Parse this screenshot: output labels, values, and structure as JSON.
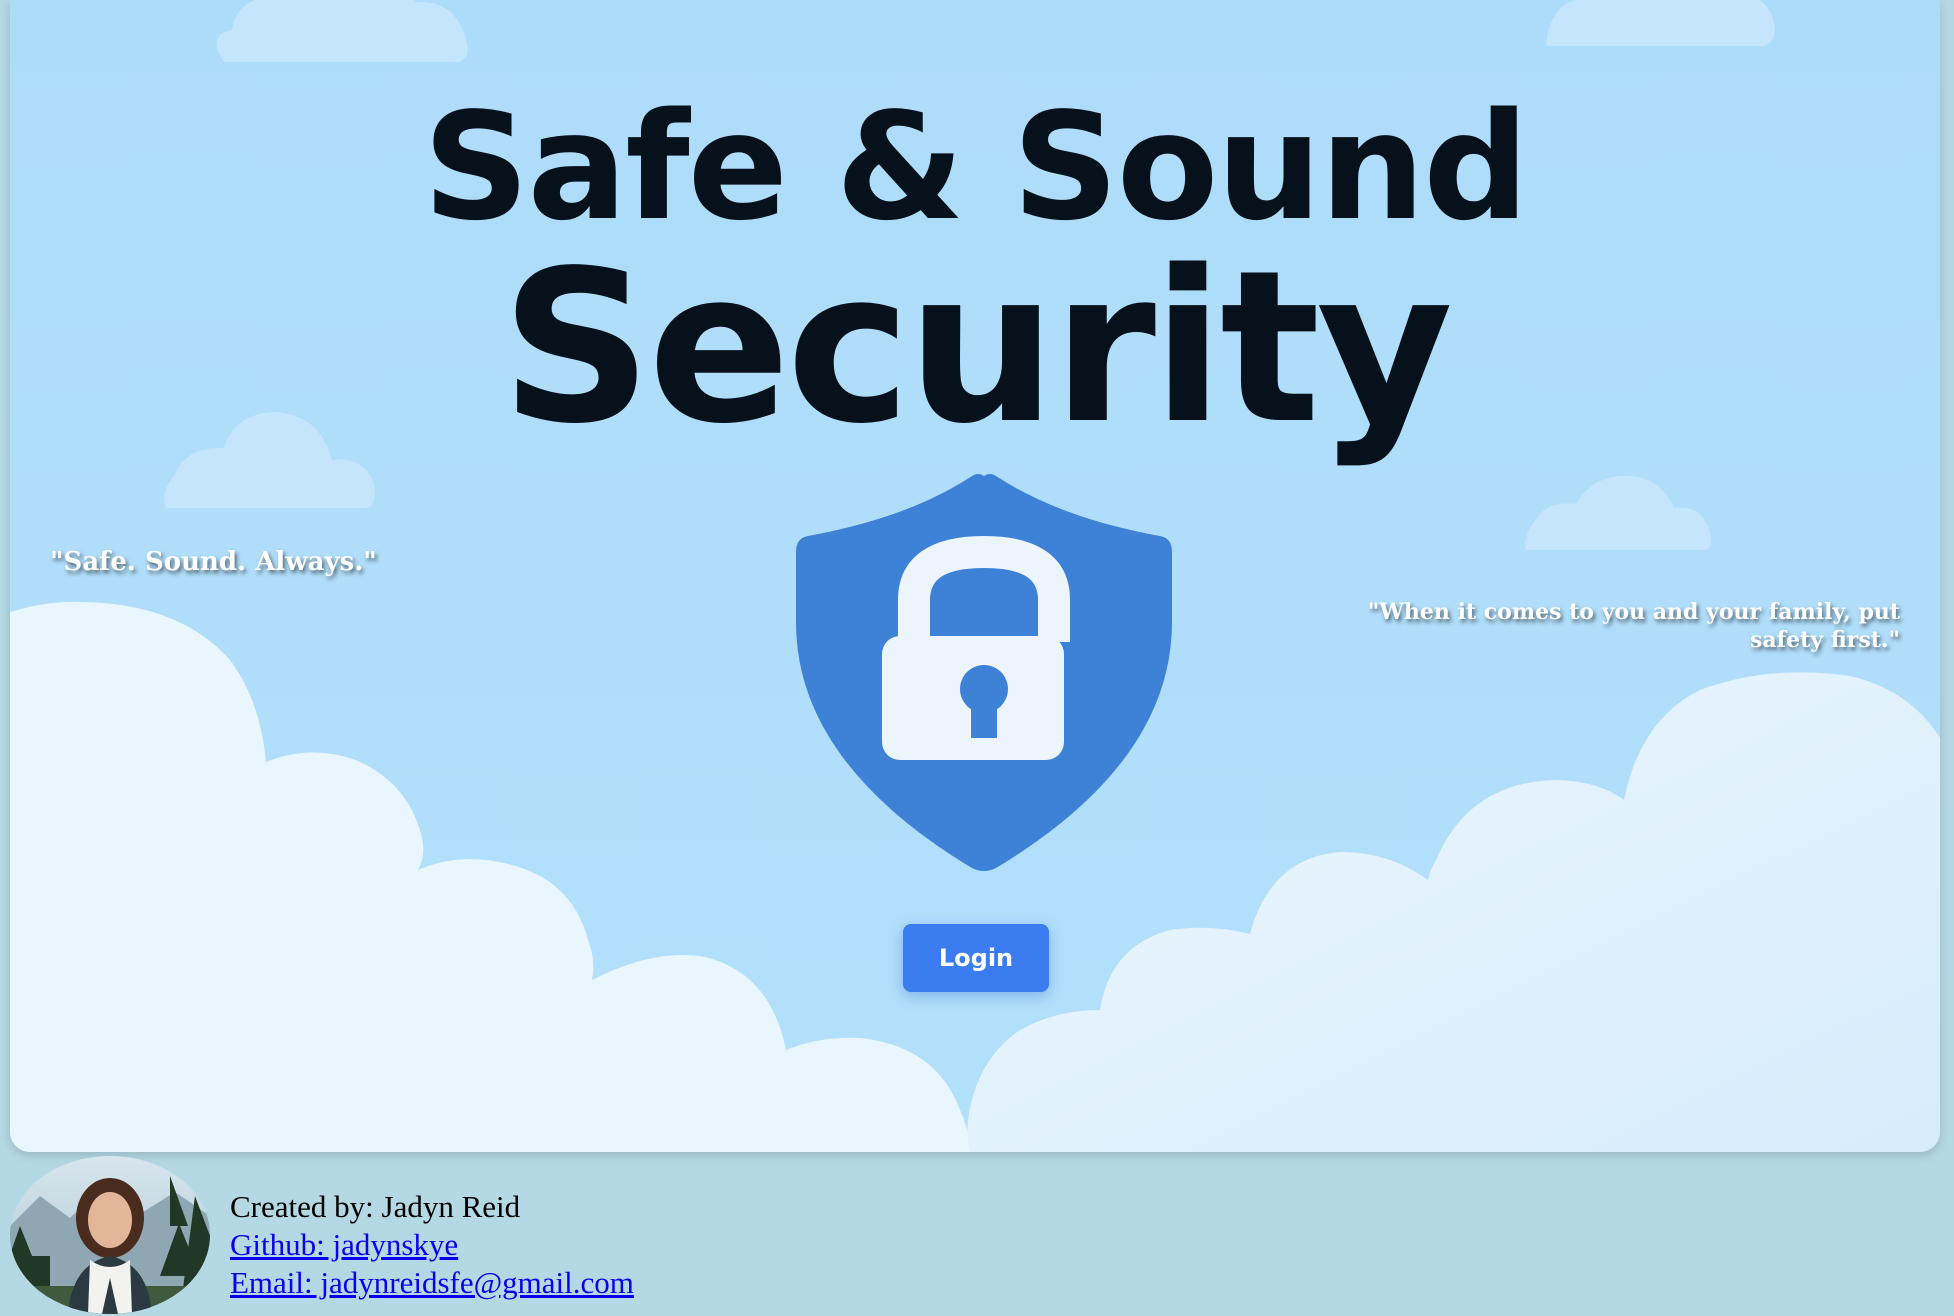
{
  "hero": {
    "title_line1": "Safe & Sound",
    "title_line2": "Security",
    "quote_left": "\"Safe. Sound. Always.\"",
    "quote_right": "\"When it comes to you and your family, put safety first.\"",
    "login_label": "Login"
  },
  "footer": {
    "created_by": "Created by: Jadyn Reid",
    "github": "Github: jadynskye",
    "email": "Email: jadynreidsfe@gmail.com"
  },
  "colors": {
    "sky": "#aedcfb",
    "cloud": "#eaf6fd",
    "shield": "#3e82d7",
    "button": "#3b7df0",
    "title": "#07111b",
    "footer_bg": "#b5d9e4",
    "link": "#0a00ee"
  },
  "icons": {
    "shield": "shield-lock-icon"
  }
}
